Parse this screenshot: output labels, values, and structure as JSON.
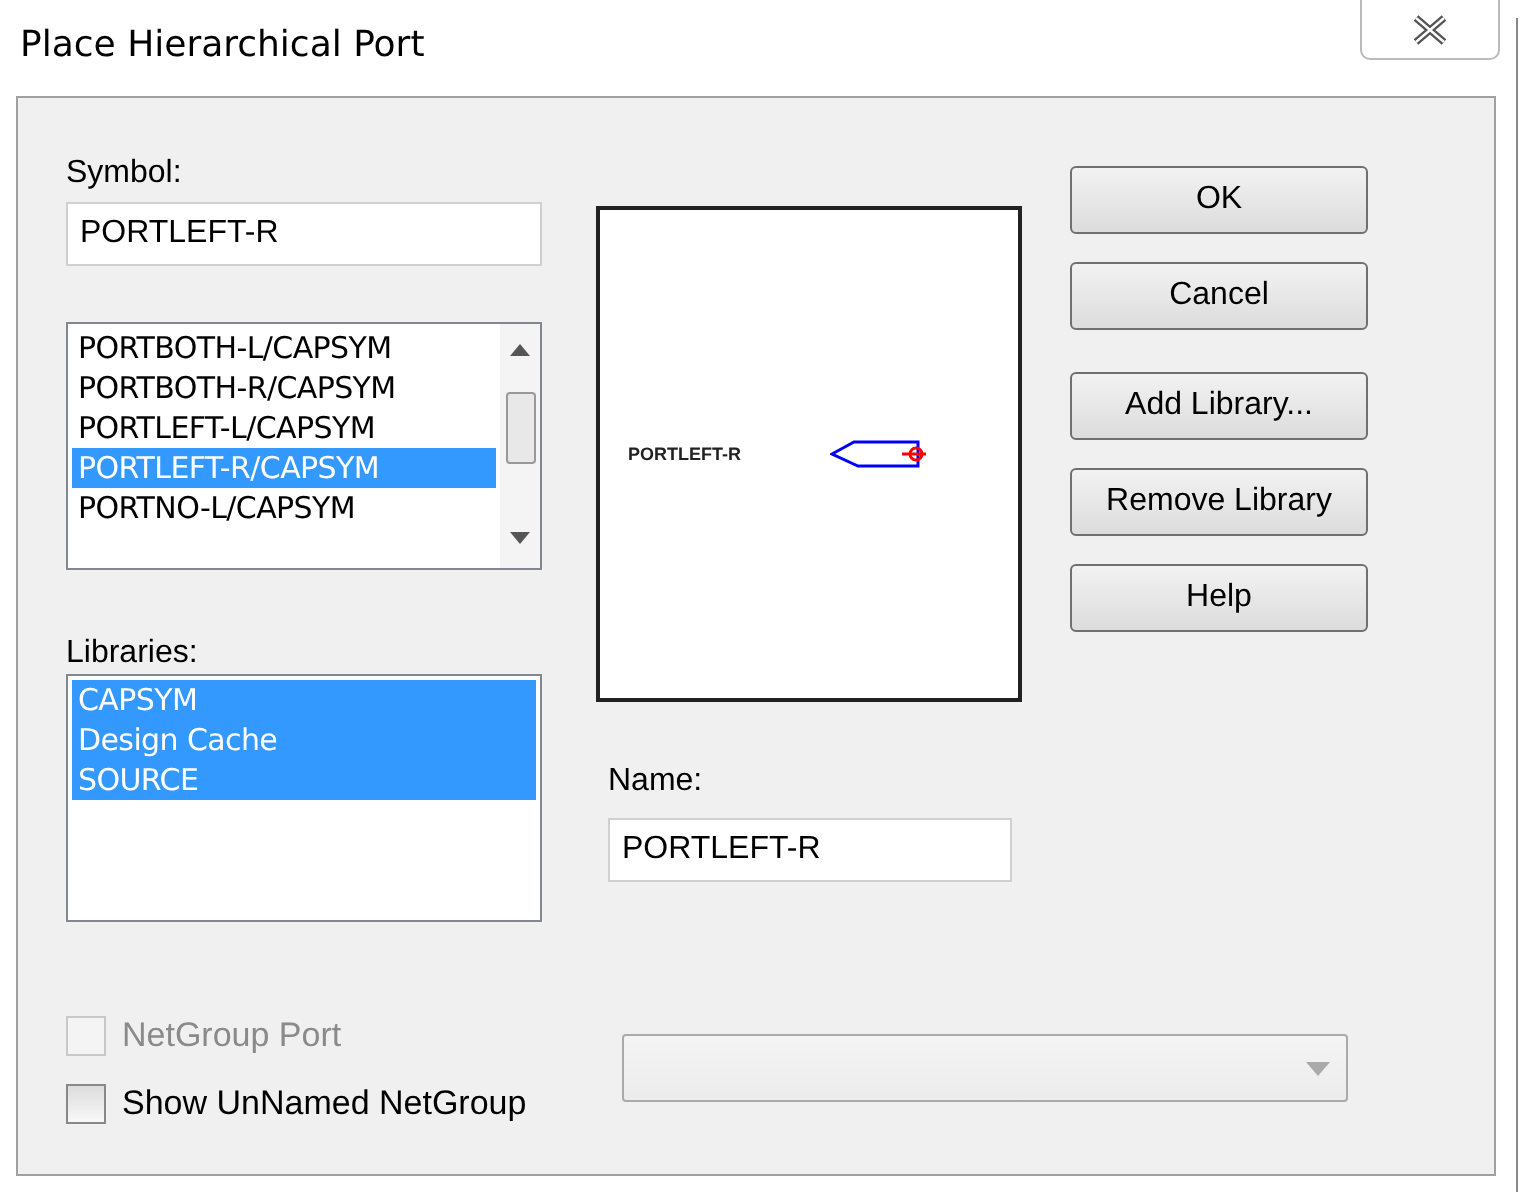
{
  "window": {
    "title": "Place Hierarchical Port"
  },
  "symbol": {
    "label": "Symbol:",
    "value": "PORTLEFT-R"
  },
  "symbol_list": {
    "items": [
      {
        "text": "PORTBOTH-L/CAPSYM",
        "selected": false
      },
      {
        "text": "PORTBOTH-R/CAPSYM",
        "selected": false
      },
      {
        "text": "PORTLEFT-L/CAPSYM",
        "selected": false
      },
      {
        "text": "PORTLEFT-R/CAPSYM",
        "selected": true
      },
      {
        "text": "PORTNO-L/CAPSYM",
        "selected": false
      }
    ]
  },
  "libraries": {
    "label": "Libraries:",
    "items": [
      {
        "text": "CAPSYM",
        "selected": true
      },
      {
        "text": "Design Cache",
        "selected": true
      },
      {
        "text": "SOURCE",
        "selected": true
      }
    ]
  },
  "preview": {
    "symbol_name": "PORTLEFT-R"
  },
  "name": {
    "label": "Name:",
    "value": "PORTLEFT-R"
  },
  "buttons": [
    "OK",
    "Cancel",
    "Add Library...",
    "Remove Library",
    "Help"
  ],
  "options": [
    {
      "label": "NetGroup Port",
      "checked": false,
      "disabled": true
    },
    {
      "label": "Show UnNamed NetGroup",
      "checked": false,
      "disabled": false
    }
  ],
  "netgroup_combo": {
    "disabled": true
  }
}
